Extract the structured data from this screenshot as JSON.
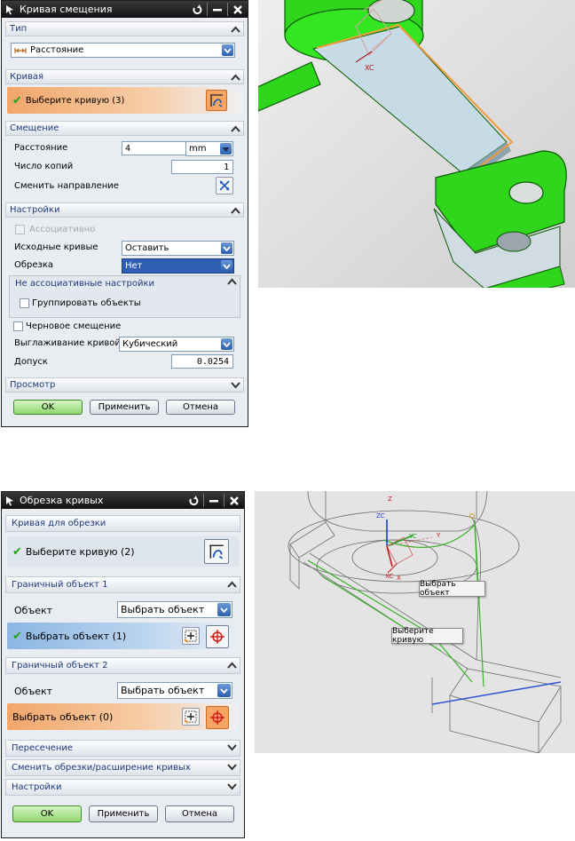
{
  "offset_dialog": {
    "title": "Кривая смещения",
    "type_section": "Тип",
    "type_value": "Расстояние",
    "curve_section": "Кривая",
    "curve_select": "Выберите кривую (3)",
    "offset_section": "Смещение",
    "distance_label": "Расстояние",
    "distance_value": "4",
    "distance_unit": "mm",
    "copies_label": "Число копий",
    "copies_value": "1",
    "reverse_label": "Сменить направление",
    "settings_section": "Настройки",
    "associative_label": "Ассоциативно",
    "input_curves_label": "Исходные кривые",
    "input_curves_value": "Оставить",
    "trim_label": "Обрезка",
    "trim_value": "Нет",
    "nonassoc_label": "Не ассоциативные настройки",
    "group_objects_label": "Группировать объекты",
    "rough_offset_label": "Черновое смещение",
    "smoothing_label": "Выглаживание кривой",
    "smoothing_value": "Кубический",
    "tolerance_label": "Допуск",
    "tolerance_value": "0.0254",
    "preview_section": "Просмотр",
    "ok": "OK",
    "apply": "Применить",
    "cancel": "Отмена"
  },
  "trim_dialog": {
    "title": "Обрезка кривых",
    "curve_section": "Кривая для обрезки",
    "curve_select": "Выберите кривую (2)",
    "boundary1_section": "Граничный объект 1",
    "object1_label": "Объект",
    "object1_value": "Выбрать объект",
    "object1_select": "Выбрать объект (1)",
    "boundary2_section": "Граничный объект 2",
    "object2_label": "Объект",
    "object2_value": "Выбрать объект",
    "object2_select": "Выбрать объект (0)",
    "intersection_section": "Пересечение",
    "extend_section": "Сменить обрезки/расширение кривых",
    "settings_section": "Настройки",
    "ok": "OK",
    "apply": "Применить",
    "cancel": "Отмена"
  },
  "viewport_top": {
    "axis_label": "XC"
  },
  "viewport_bottom": {
    "axis_z": "Z",
    "axis_zc": "ZC",
    "axis_yc": "YC",
    "axis_y": "Y",
    "axis_xc": "XC",
    "axis_x": "X",
    "tooltip_object": "Выбрать объект",
    "tooltip_curve": "Выберите кривую"
  },
  "colors": {
    "selection_orange": "#f7a15c",
    "selection_blue": "#9cc2ea",
    "check_green": "#27a11d",
    "part_green": "#33e01f",
    "section_text": "#1d3a7a"
  }
}
